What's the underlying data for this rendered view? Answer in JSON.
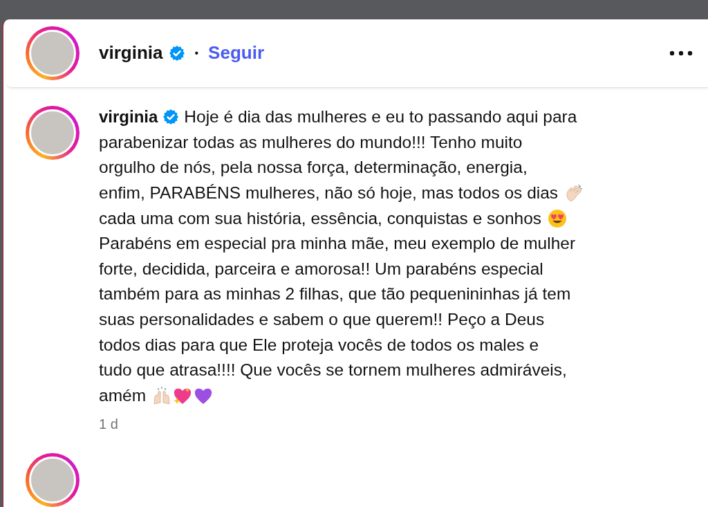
{
  "header": {
    "username": "virginia",
    "verified": true,
    "separator": "•",
    "follow": "Seguir"
  },
  "post": {
    "username": "virginia",
    "verified": true,
    "caption": [
      "Hoje é dia das mulheres e eu to passando aqui para",
      "parabenizar todas as mulheres do mundo!!! Tenho muito",
      "orgulho de nós, pela nossa força, determinação, energia,",
      "enfim, PARABÉNS mulheres, não só hoje, mas todos os dias",
      "cada uma com sua história, essência, conquistas e sonhos",
      "Parabéns em especial pra minha mãe, meu exemplo de mulher",
      "forte, decidida, parceira e amorosa!! Um parabéns especial",
      "também para as minhas 2 filhas, que tão pequenininhas já tem",
      "suas personalidades e sabem o que querem!! Peço a Deus",
      "todos dias para que Ele proteja vocês de todos os males e",
      "tudo que atrasa!!!! Que vocês se tornem mulheres admiráveis,",
      "amém"
    ],
    "time": "1 d"
  }
}
